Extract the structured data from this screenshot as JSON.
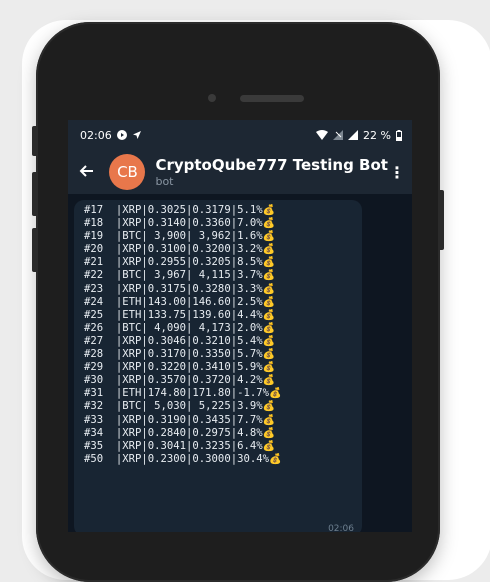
{
  "status_bar": {
    "time": "02:06",
    "battery": "22 %"
  },
  "chat_header": {
    "avatar_initials": "CB",
    "title": "CryptoQube777 Testing Bot",
    "subtitle": "bot"
  },
  "message": {
    "time": "02:06",
    "lines": [
      "#17  |XRP|0.3025|0.3179|5.1%",
      "#18  |XRP|0.3140|0.3360|7.0%",
      "#19  |BTC| 3,900| 3,962|1.6%",
      "#20  |XRP|0.3100|0.3200|3.2%",
      "#21  |XRP|0.2955|0.3205|8.5%",
      "#22  |BTC| 3,967| 4,115|3.7%",
      "#23  |XRP|0.3175|0.3280|3.3%",
      "#24  |ETH|143.00|146.60|2.5%",
      "#25  |ETH|133.75|139.60|4.4%",
      "#26  |BTC| 4,090| 4,173|2.0%",
      "#27  |XRP|0.3046|0.3210|5.4%",
      "#28  |XRP|0.3170|0.3350|5.7%",
      "#29  |XRP|0.3220|0.3410|5.9%",
      "#30  |XRP|0.3570|0.3720|4.2%",
      "#31  |ETH|174.80|171.80|-1.7%",
      "#32  |BTC| 5,030| 5,225|3.9%",
      "#33  |XRP|0.3190|0.3435|7.7%",
      "#34  |XRP|0.2840|0.2975|4.8%",
      "#35  |XRP|0.3041|0.3235|6.4%",
      "#50  |XRP|0.2300|0.3000|30.4%"
    ],
    "suffix_icon": "money-bag-icon"
  }
}
